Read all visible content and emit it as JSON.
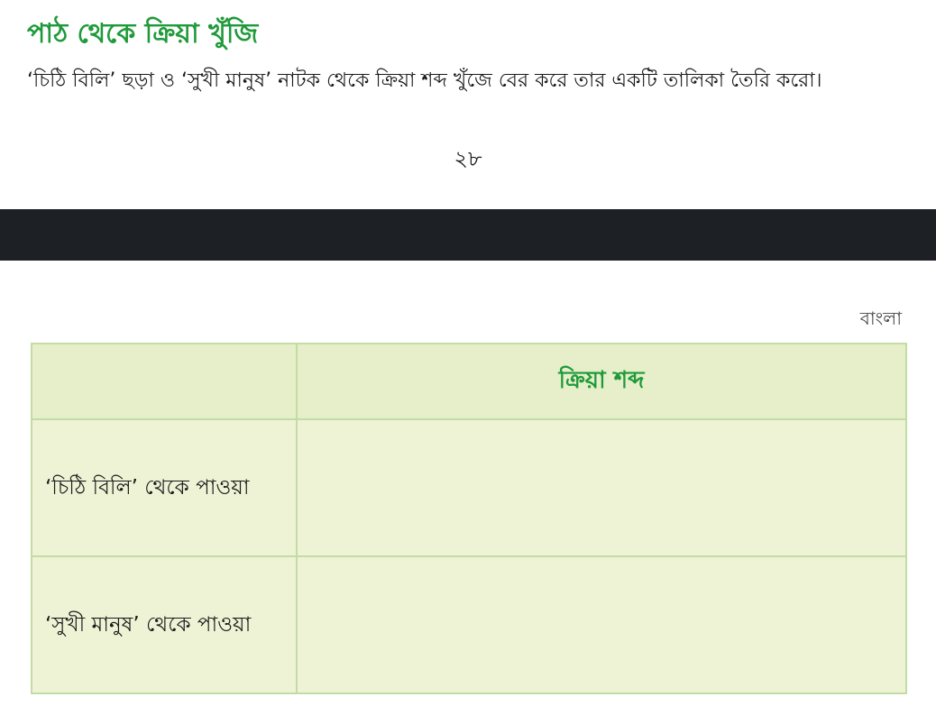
{
  "top_page": {
    "section_title": "পাঠ থেকে ক্রিয়া খুঁজি",
    "instruction": "‘চিঠি বিলি’ ছড়া ও ‘সুখী মানুষ’ নাটক থেকে ক্রিয়া শব্দ খুঁজে বের করে তার একটি তালিকা তৈরি করো।",
    "page_number": "২৮"
  },
  "bottom_page": {
    "running_header": "বাংলা",
    "table": {
      "columns": [
        "",
        "ক্রিয়া শব্দ"
      ],
      "rows": [
        {
          "label": "‘চিঠি বিলি’ থেকে পাওয়া",
          "value": ""
        },
        {
          "label": "‘সুখী মানুষ’ থেকে পাওয়া",
          "value": ""
        }
      ]
    }
  },
  "colors": {
    "title_green": "#1f9a3a",
    "table_border": "#c3dca4",
    "table_fill": "#eef3d6",
    "gap_dark": "#1d2024"
  }
}
